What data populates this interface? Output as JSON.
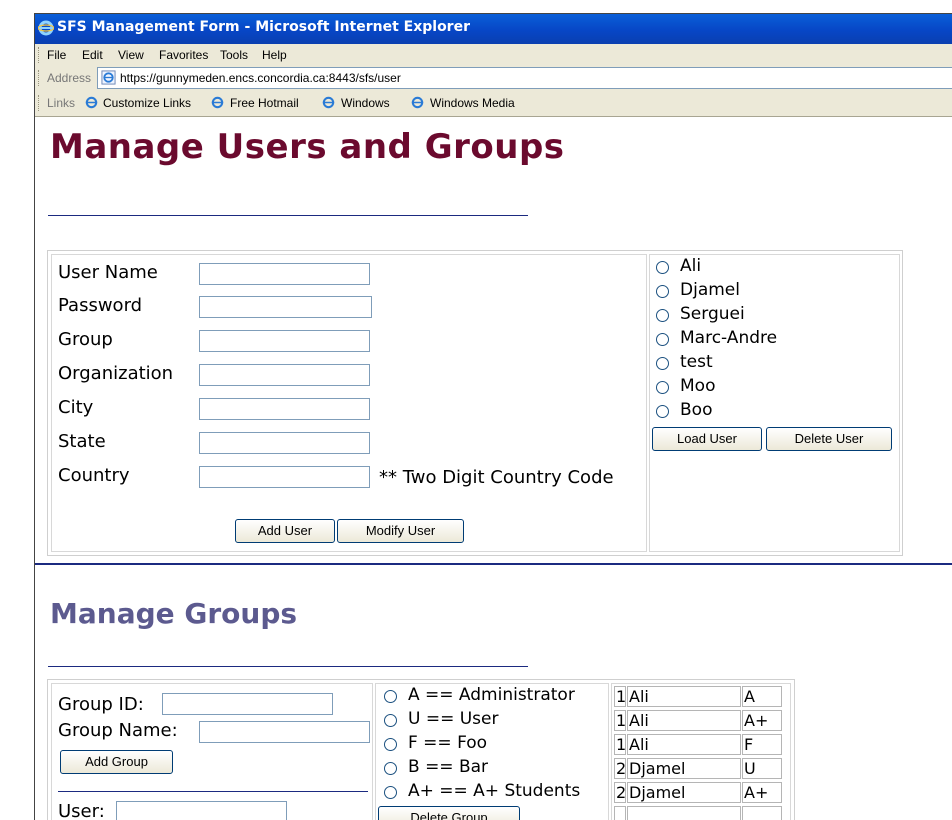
{
  "window": {
    "title": "SFS Management Form - Microsoft Internet Explorer"
  },
  "menu": [
    "File",
    "Edit",
    "View",
    "Favorites",
    "Tools",
    "Help"
  ],
  "address": {
    "label": "Address",
    "url": "https://gunnymeden.encs.concordia.ca:8443/sfs/user"
  },
  "links": {
    "label": "Links",
    "items": [
      "Customize Links",
      "Free Hotmail",
      "Windows",
      "Windows Media"
    ]
  },
  "users_section": {
    "heading": "Manage Users and Groups",
    "fields": [
      "User Name",
      "Password",
      "Group",
      "Organization",
      "City",
      "State",
      "Country"
    ],
    "country_note": "** Two Digit Country Code",
    "add_button": "Add User",
    "modify_button": "Modify User",
    "user_list": [
      "Ali",
      "Djamel",
      "Serguei",
      "Marc-Andre",
      "test",
      "Moo",
      "Boo"
    ],
    "load_button": "Load User",
    "delete_button": "Delete User"
  },
  "groups_section": {
    "heading": "Manage Groups",
    "group_id_label": "Group ID:",
    "group_name_label": "Group Name:",
    "add_group_button": "Add Group",
    "user_label": "User:",
    "group_list": [
      "A == Administrator",
      "U == User",
      "F == Foo",
      "B == Bar",
      "A+ == A+ Students"
    ],
    "delete_group_button": "Delete Group",
    "membership_table": [
      [
        "1",
        "Ali",
        "A"
      ],
      [
        "1",
        "Ali",
        "A+"
      ],
      [
        "1",
        "Ali",
        "F"
      ],
      [
        "2",
        "Djamel",
        "U"
      ],
      [
        "2",
        "Djamel",
        "A+"
      ]
    ]
  },
  "colors": {
    "title_bar": "#0746c6",
    "heading_users": "#6b0a2e",
    "heading_groups": "#5c5a8f",
    "rule": "#1b2a80"
  }
}
